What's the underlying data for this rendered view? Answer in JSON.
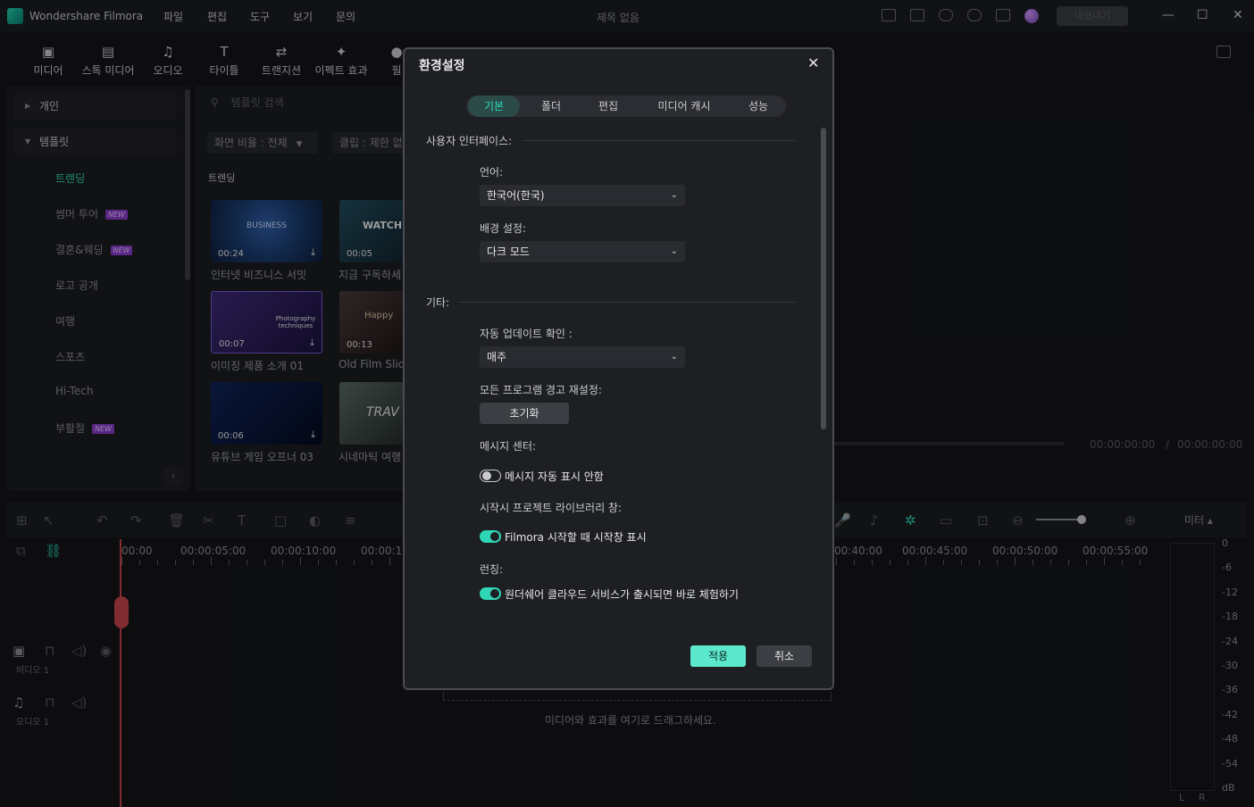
{
  "app": {
    "name": "Wondershare Filmora",
    "doc_title": "제목 없음",
    "menu": [
      "파일",
      "편집",
      "도구",
      "보기",
      "문의"
    ],
    "buy_label": "내보내기"
  },
  "toolbar": {
    "items": [
      {
        "label": "미디어",
        "icon": "media-icon"
      },
      {
        "label": "스톡 미디어",
        "icon": "stock-media-icon"
      },
      {
        "label": "오디오",
        "icon": "audio-icon"
      },
      {
        "label": "타이틀",
        "icon": "title-icon"
      },
      {
        "label": "트랜지션",
        "icon": "transition-icon"
      },
      {
        "label": "이펙트 효과",
        "icon": "effects-icon"
      },
      {
        "label": "필",
        "icon": "filter-icon"
      }
    ]
  },
  "sidebar": {
    "categories": [
      {
        "label": "개인",
        "expanded": false
      },
      {
        "label": "템플릿",
        "expanded": true
      }
    ],
    "items": [
      {
        "label": "트렌딩",
        "active": true,
        "new": false
      },
      {
        "label": "썸머 투어",
        "active": false,
        "new": true
      },
      {
        "label": "결혼&웨딩",
        "active": false,
        "new": true
      },
      {
        "label": "로고 공개",
        "active": false,
        "new": false
      },
      {
        "label": "여행",
        "active": false,
        "new": false
      },
      {
        "label": "스포츠",
        "active": false,
        "new": false
      },
      {
        "label": "Hi-Tech",
        "active": false,
        "new": false
      },
      {
        "label": "부활절",
        "active": false,
        "new": true
      }
    ],
    "new_badge": "NEW"
  },
  "library": {
    "search_placeholder": "템플릿 검색",
    "filter_ratio": "화면 비율 : 전체",
    "filter_clip": "클립 : 제한 없",
    "section": "트렌딩",
    "thumbs": [
      {
        "label": "인터넷 비즈니스 서밋",
        "duration": "00:24",
        "caption": "BUSINESS",
        "color": "#1a3b6e"
      },
      {
        "label": "지금 구독하세",
        "duration": "00:05",
        "caption": "WATCH",
        "color": "#1c3a4a"
      },
      {
        "label": "이미징 제품 소개 01",
        "duration": "00:07",
        "caption": "Photography techniques",
        "color": "#2a1c52"
      },
      {
        "label": "Old Film Slid",
        "duration": "00:13",
        "caption": "Happy",
        "color": "#3a3030"
      },
      {
        "label": "유튜브 게임 오프너 03",
        "duration": "00:06",
        "caption": "",
        "color": "#0f1e3e"
      },
      {
        "label": "시네마틱 여행",
        "duration": "",
        "caption": "TRAV",
        "color": "#3a4a44"
      }
    ]
  },
  "preview": {
    "time_current": "00:00:00:00",
    "time_total": "00:00:00:00",
    "separator": "/"
  },
  "timeline": {
    "ruler_labels": [
      "00:00",
      "00:00:05:00",
      "00:00:10:00",
      "00:00:15",
      "00:40:00",
      "00:00:45:00",
      "00:00:50:00",
      "00:00:55:00"
    ],
    "video_track": "비디오 1",
    "audio_track": "오디오 1",
    "drop_hint": "미디어와 효과를 여기로 드래그하세요.",
    "meter_label": "미터 ▴",
    "meter_scale": [
      "0",
      "-6",
      "-12",
      "-18",
      "-24",
      "-30",
      "-36",
      "-42",
      "-48",
      "-54",
      "dB"
    ],
    "meter_channels": [
      "L",
      "R"
    ]
  },
  "dialog": {
    "title": "환경설정",
    "tabs": [
      "기본",
      "폴더",
      "편집",
      "미디어 캐시",
      "성능"
    ],
    "active_tab": "기본",
    "ui_group": "사용자 인터페이스:",
    "language_label": "언어:",
    "language_value": "한국어(한국)",
    "theme_label": "배경 설정:",
    "theme_value": "다크 모드",
    "other_group": "기타:",
    "update_label": "자동 업데이트 확인 :",
    "update_value": "매주",
    "reset_label": "모든 프로그램 경고 재설정:",
    "reset_button": "초기화",
    "msg_center_label": "메시지 센터:",
    "msg_toggle": "메시지 자동 표시 안함",
    "msg_toggle_on": false,
    "project_lib_label": "시작시 프로젝트 라이브러리 창:",
    "project_lib_toggle": "Filmora 시작할 때 시작창 표시",
    "project_lib_on": true,
    "launch_label": "런칭:",
    "launch_toggle": "원더쉐어 클라우드 서비스가 출시되면 바로 체험하기",
    "launch_on": true,
    "apply": "적용",
    "cancel": "취소"
  }
}
